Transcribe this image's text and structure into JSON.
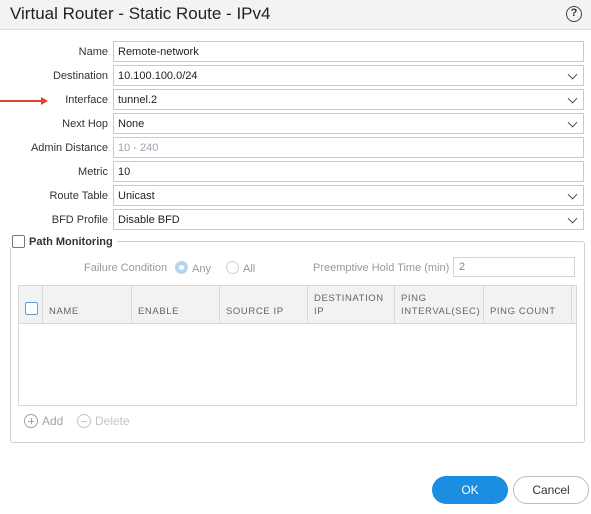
{
  "dialog": {
    "title": "Virtual Router - Static Route - IPv4",
    "help_icon": "?"
  },
  "fields": {
    "name": {
      "label": "Name",
      "value": "Remote-network"
    },
    "destination": {
      "label": "Destination",
      "value": "10.100.100.0/24"
    },
    "interface": {
      "label": "Interface",
      "value": "tunnel.2"
    },
    "next_hop": {
      "label": "Next Hop",
      "value": "None"
    },
    "admin_distance": {
      "label": "Admin Distance",
      "placeholder": "10 - 240"
    },
    "metric": {
      "label": "Metric",
      "value": "10"
    },
    "route_table": {
      "label": "Route Table",
      "value": "Unicast"
    },
    "bfd_profile": {
      "label": "BFD Profile",
      "value": "Disable BFD"
    }
  },
  "path_monitoring": {
    "label": "Path Monitoring",
    "checked": false,
    "failure_condition_label": "Failure Condition",
    "options": [
      "Any",
      "All"
    ],
    "selected": "Any",
    "preemptive_hold_label": "Preemptive Hold Time (min)",
    "preemptive_hold_value": "2",
    "columns": [
      "NAME",
      "ENABLE",
      "SOURCE IP",
      "DESTINATION IP",
      "PING INTERVAL(SEC)",
      "PING COUNT"
    ],
    "add_label": "Add",
    "delete_label": "Delete"
  },
  "buttons": {
    "ok": "OK",
    "cancel": "Cancel"
  },
  "colors": {
    "accent": "#1a8ee0",
    "annotation_arrow": "#e0442b"
  }
}
